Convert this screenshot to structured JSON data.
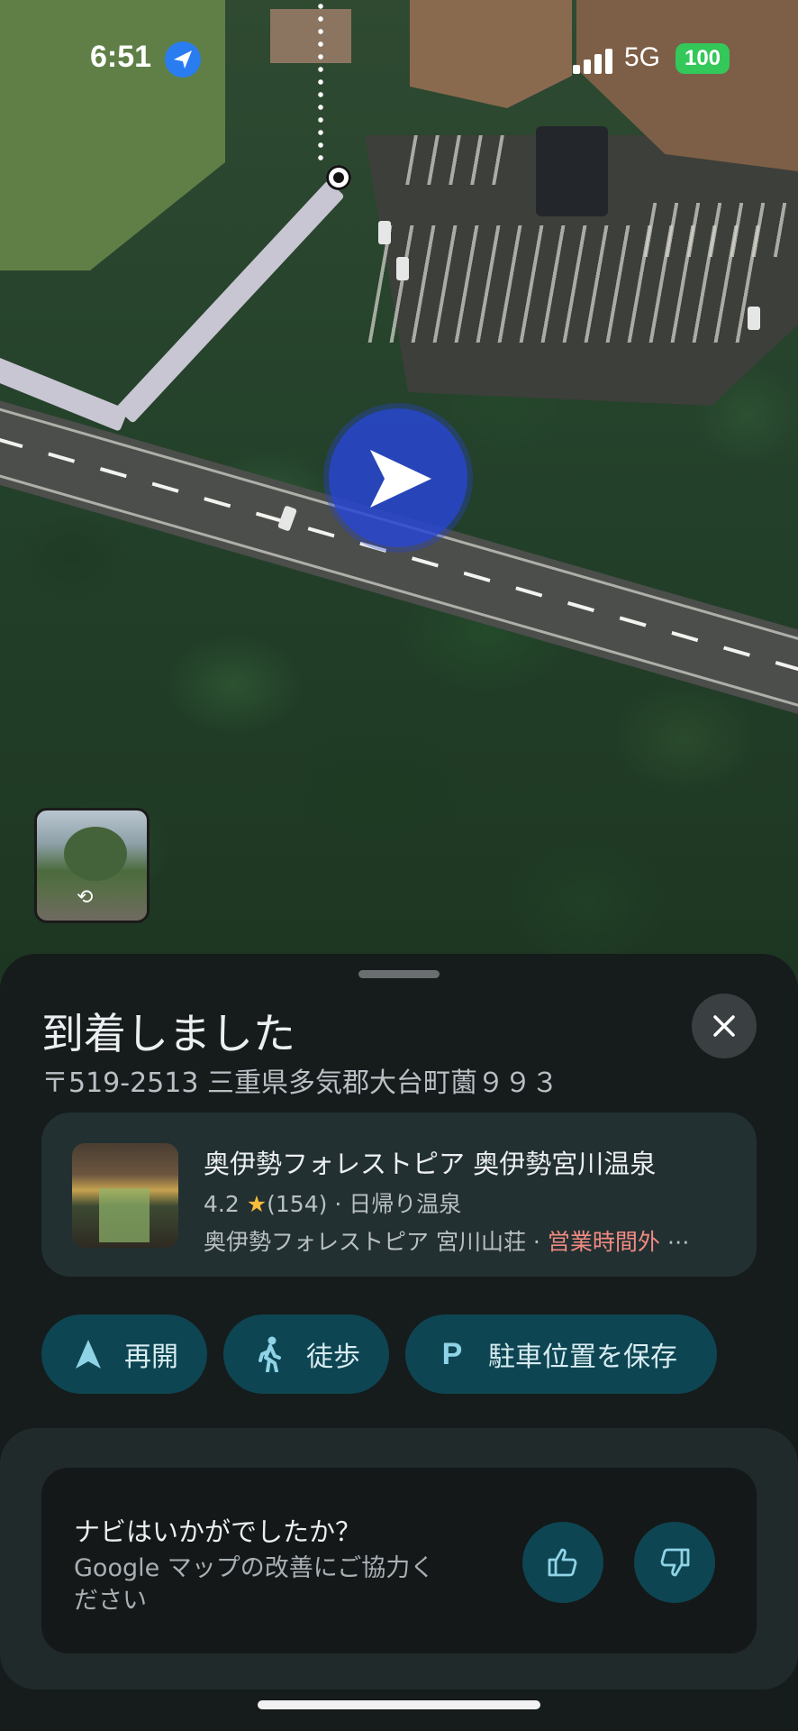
{
  "status_bar": {
    "time": "6:51",
    "network": "5G",
    "battery": "100",
    "battery_color": "#34c759"
  },
  "map": {
    "puck_color": "#2846d2",
    "street_view_icon": "rotate-360-icon"
  },
  "sheet": {
    "title": "到着しました",
    "address": "〒519-2513 三重県多気郡大台町薗９９３",
    "close_icon": "close-icon",
    "place": {
      "name": "奥伊勢フォレストピア 奥伊勢宮川温泉",
      "rating": "4.2",
      "reviews": "(154)",
      "category": "日帰り温泉",
      "sub_name": "奥伊勢フォレストピア 宮川山荘",
      "hours_status": "営業時間外",
      "more": "⋯"
    },
    "actions": [
      {
        "label": "再開",
        "icon": "navigation-arrow-icon"
      },
      {
        "label": "徒歩",
        "icon": "walking-icon"
      },
      {
        "label": "駐車位置を保存",
        "icon": "parking-icon"
      }
    ],
    "feedback": {
      "question": "ナビはいかがでしたか？",
      "subtitle": "Google マップの改善にご協力ください",
      "like_icon": "thumbs-up-icon",
      "dislike_icon": "thumbs-down-icon"
    }
  },
  "colors": {
    "sheet_bg": "#161b1c",
    "chip_bg": "#0e4552",
    "closed_text": "#f28b82"
  }
}
